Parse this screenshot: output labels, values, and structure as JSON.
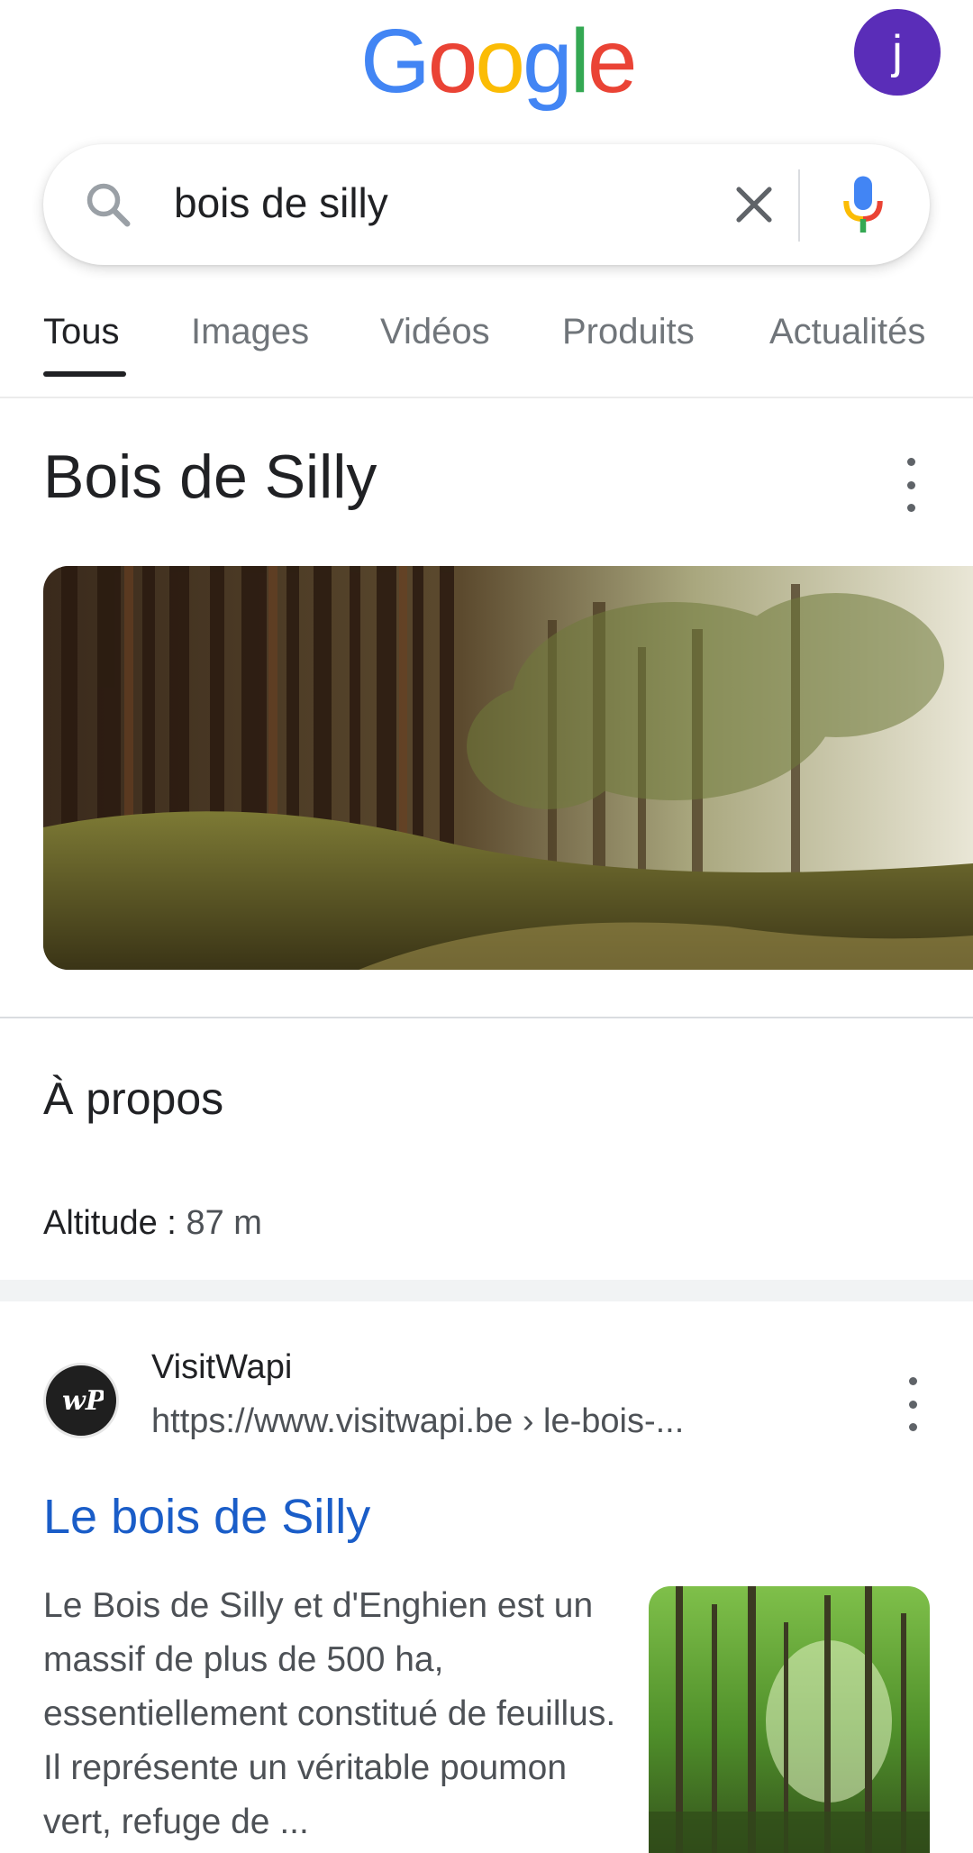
{
  "header": {
    "logo": [
      "G",
      "o",
      "o",
      "g",
      "l",
      "e"
    ],
    "avatar_letter": "j"
  },
  "search": {
    "query": "bois de silly"
  },
  "tabs": [
    {
      "label": "Tous",
      "active": true
    },
    {
      "label": "Images",
      "active": false
    },
    {
      "label": "Vidéos",
      "active": false
    },
    {
      "label": "Produits",
      "active": false
    },
    {
      "label": "Actualités",
      "active": false
    }
  ],
  "knowledge_panel": {
    "title": "Bois de Silly",
    "about_heading": "À propos",
    "attribute_label": "Altitude",
    "attribute_sep": " : ",
    "attribute_value": "87 m"
  },
  "result": {
    "site_name": "VisitWapi",
    "url": "https://www.visitwapi.be › le-bois-...",
    "title": "Le bois de Silly",
    "snippet": "Le Bois de Silly et d'Enghien est un massif de plus de 500 ha, essentiellement constitué de feuillus. Il représente un véritable poumon vert, refuge de ..."
  },
  "colors": {
    "google_blue": "#4285F4",
    "google_red": "#EA4335",
    "google_yellow": "#FBBC05",
    "google_green": "#34A853",
    "avatar_bg": "#5a2db8",
    "link_blue": "#1a5dc8"
  },
  "icons": [
    "search-icon",
    "clear-icon",
    "mic-icon",
    "more-vert-icon",
    "site-favicon"
  ]
}
